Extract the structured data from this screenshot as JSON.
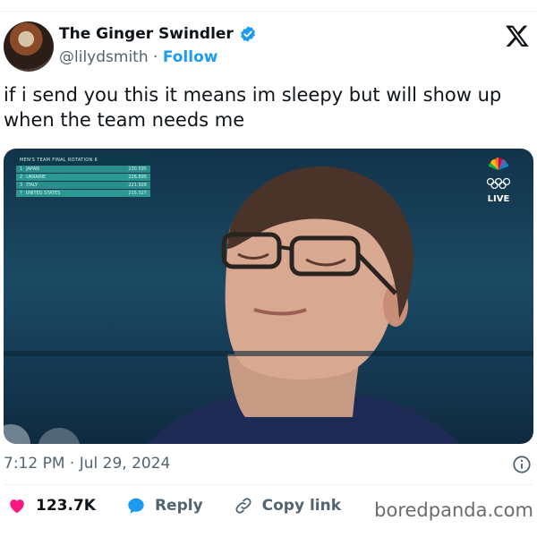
{
  "tweet": {
    "display_name": "The Ginger Swindler",
    "handle": "@lilydsmith",
    "separator": "·",
    "follow_label": "Follow",
    "text": "if i send you this it means im sleepy but will show up when the team needs me",
    "timestamp": "7:12 PM · Jul 29, 2024"
  },
  "media": {
    "scoreboard": {
      "title": "MEN'S TEAM FINAL  ROTATION 6",
      "rows": [
        {
          "rank": "1",
          "country": "JAPAN",
          "score": "230.595"
        },
        {
          "rank": "2",
          "country": "UKRAINE",
          "score": "226.895"
        },
        {
          "rank": "3",
          "country": "ITALY",
          "score": "221.928"
        },
        {
          "rank": "?",
          "country": "UNITED STATES",
          "score": "215.327"
        }
      ]
    },
    "live_label": "LIVE"
  },
  "actions": {
    "likes": "123.7K",
    "reply": "Reply",
    "copy": "Copy link"
  },
  "watermark": "boredpanda.com",
  "colors": {
    "accent_blue": "#1d9bf0",
    "like_pink": "#f91880",
    "muted_text": "#536471"
  }
}
